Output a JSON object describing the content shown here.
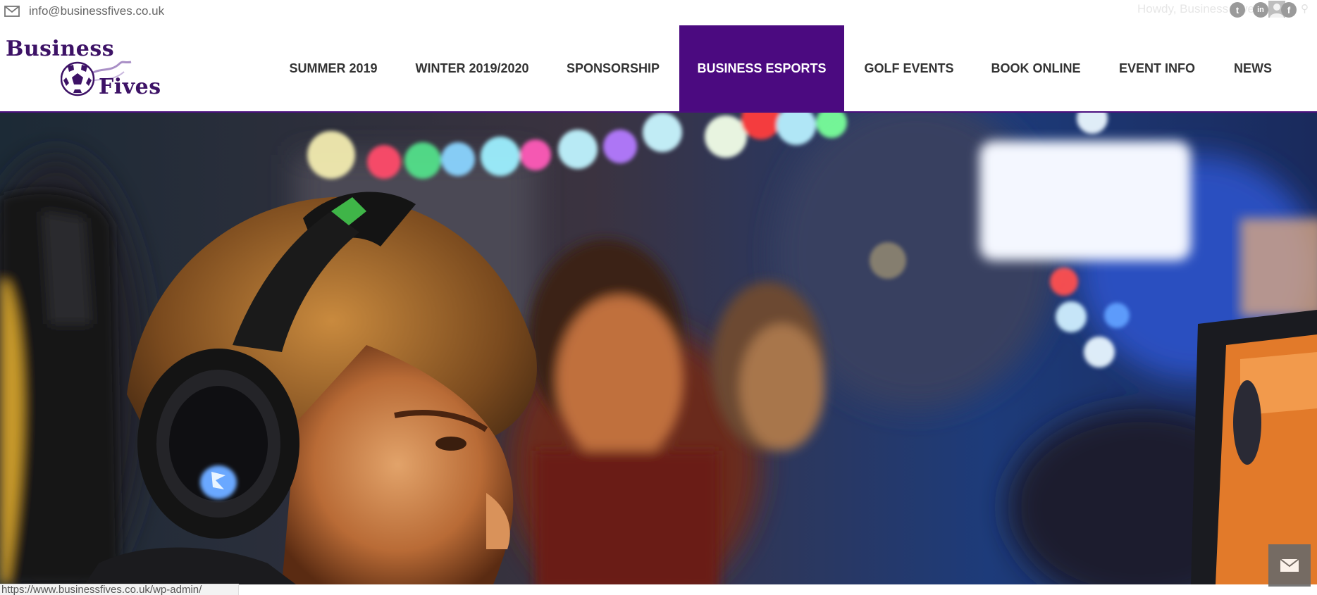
{
  "topbar": {
    "email": "info@businessfives.co.uk",
    "howdy": "Howdy, Business Fives",
    "social": [
      {
        "icon": "twitter-icon",
        "glyph": "t"
      },
      {
        "icon": "linkedin-icon",
        "glyph": "in"
      },
      {
        "icon": "facebook-icon",
        "glyph": "f"
      }
    ]
  },
  "logo": {
    "line1": "Business",
    "line2": "Fives",
    "brand_color": "#3d1266"
  },
  "nav": {
    "items": [
      {
        "label": "SUMMER 2019",
        "active": false
      },
      {
        "label": "WINTER 2019/2020",
        "active": false
      },
      {
        "label": "SPONSORSHIP",
        "active": false
      },
      {
        "label": "BUSINESS ESPORTS",
        "active": true
      },
      {
        "label": "GOLF EVENTS",
        "active": false
      },
      {
        "label": "BOOK ONLINE",
        "active": false
      },
      {
        "label": "EVENT INFO",
        "active": false
      },
      {
        "label": "NEWS",
        "active": false
      }
    ],
    "active_color": "#4b0a80"
  },
  "hero": {
    "alt": "gaming-photo"
  },
  "status_bar": {
    "url": "https://www.businessfives.co.uk/wp-admin/"
  },
  "contact_button": {
    "icon": "envelope-icon"
  }
}
